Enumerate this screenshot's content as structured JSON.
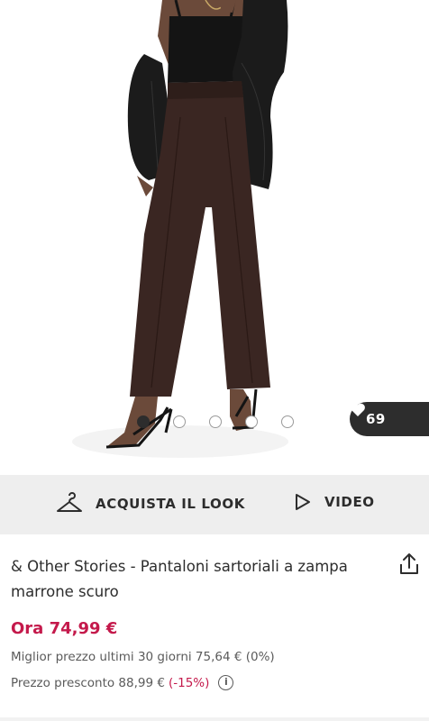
{
  "gallery": {
    "image_alt": "Model wearing dark brown wide leg tailored trousers with black top and black jacket",
    "dot_count": 5,
    "active_dot": 0,
    "likes_count": "69"
  },
  "actions": {
    "shop_look_label": "ACQUISTA IL LOOK",
    "video_label": "VIDEO"
  },
  "product": {
    "title": "& Other Stories - Pantaloni sartoriali a zampa marrone scuro",
    "price_now": "Ora 74,99 €",
    "best_price_text": "Miglior prezzo ultimi 30 giorni 75,64 € (0%)",
    "rrp_text": "Prezzo presconto 88,99 €",
    "rrp_discount": "(-15%)",
    "info_symbol": "i"
  },
  "colors": {
    "accent": "#c4194b",
    "dark": "#2d2d2d",
    "bar_bg": "#eeeeee",
    "trousers": "#3a2622"
  }
}
